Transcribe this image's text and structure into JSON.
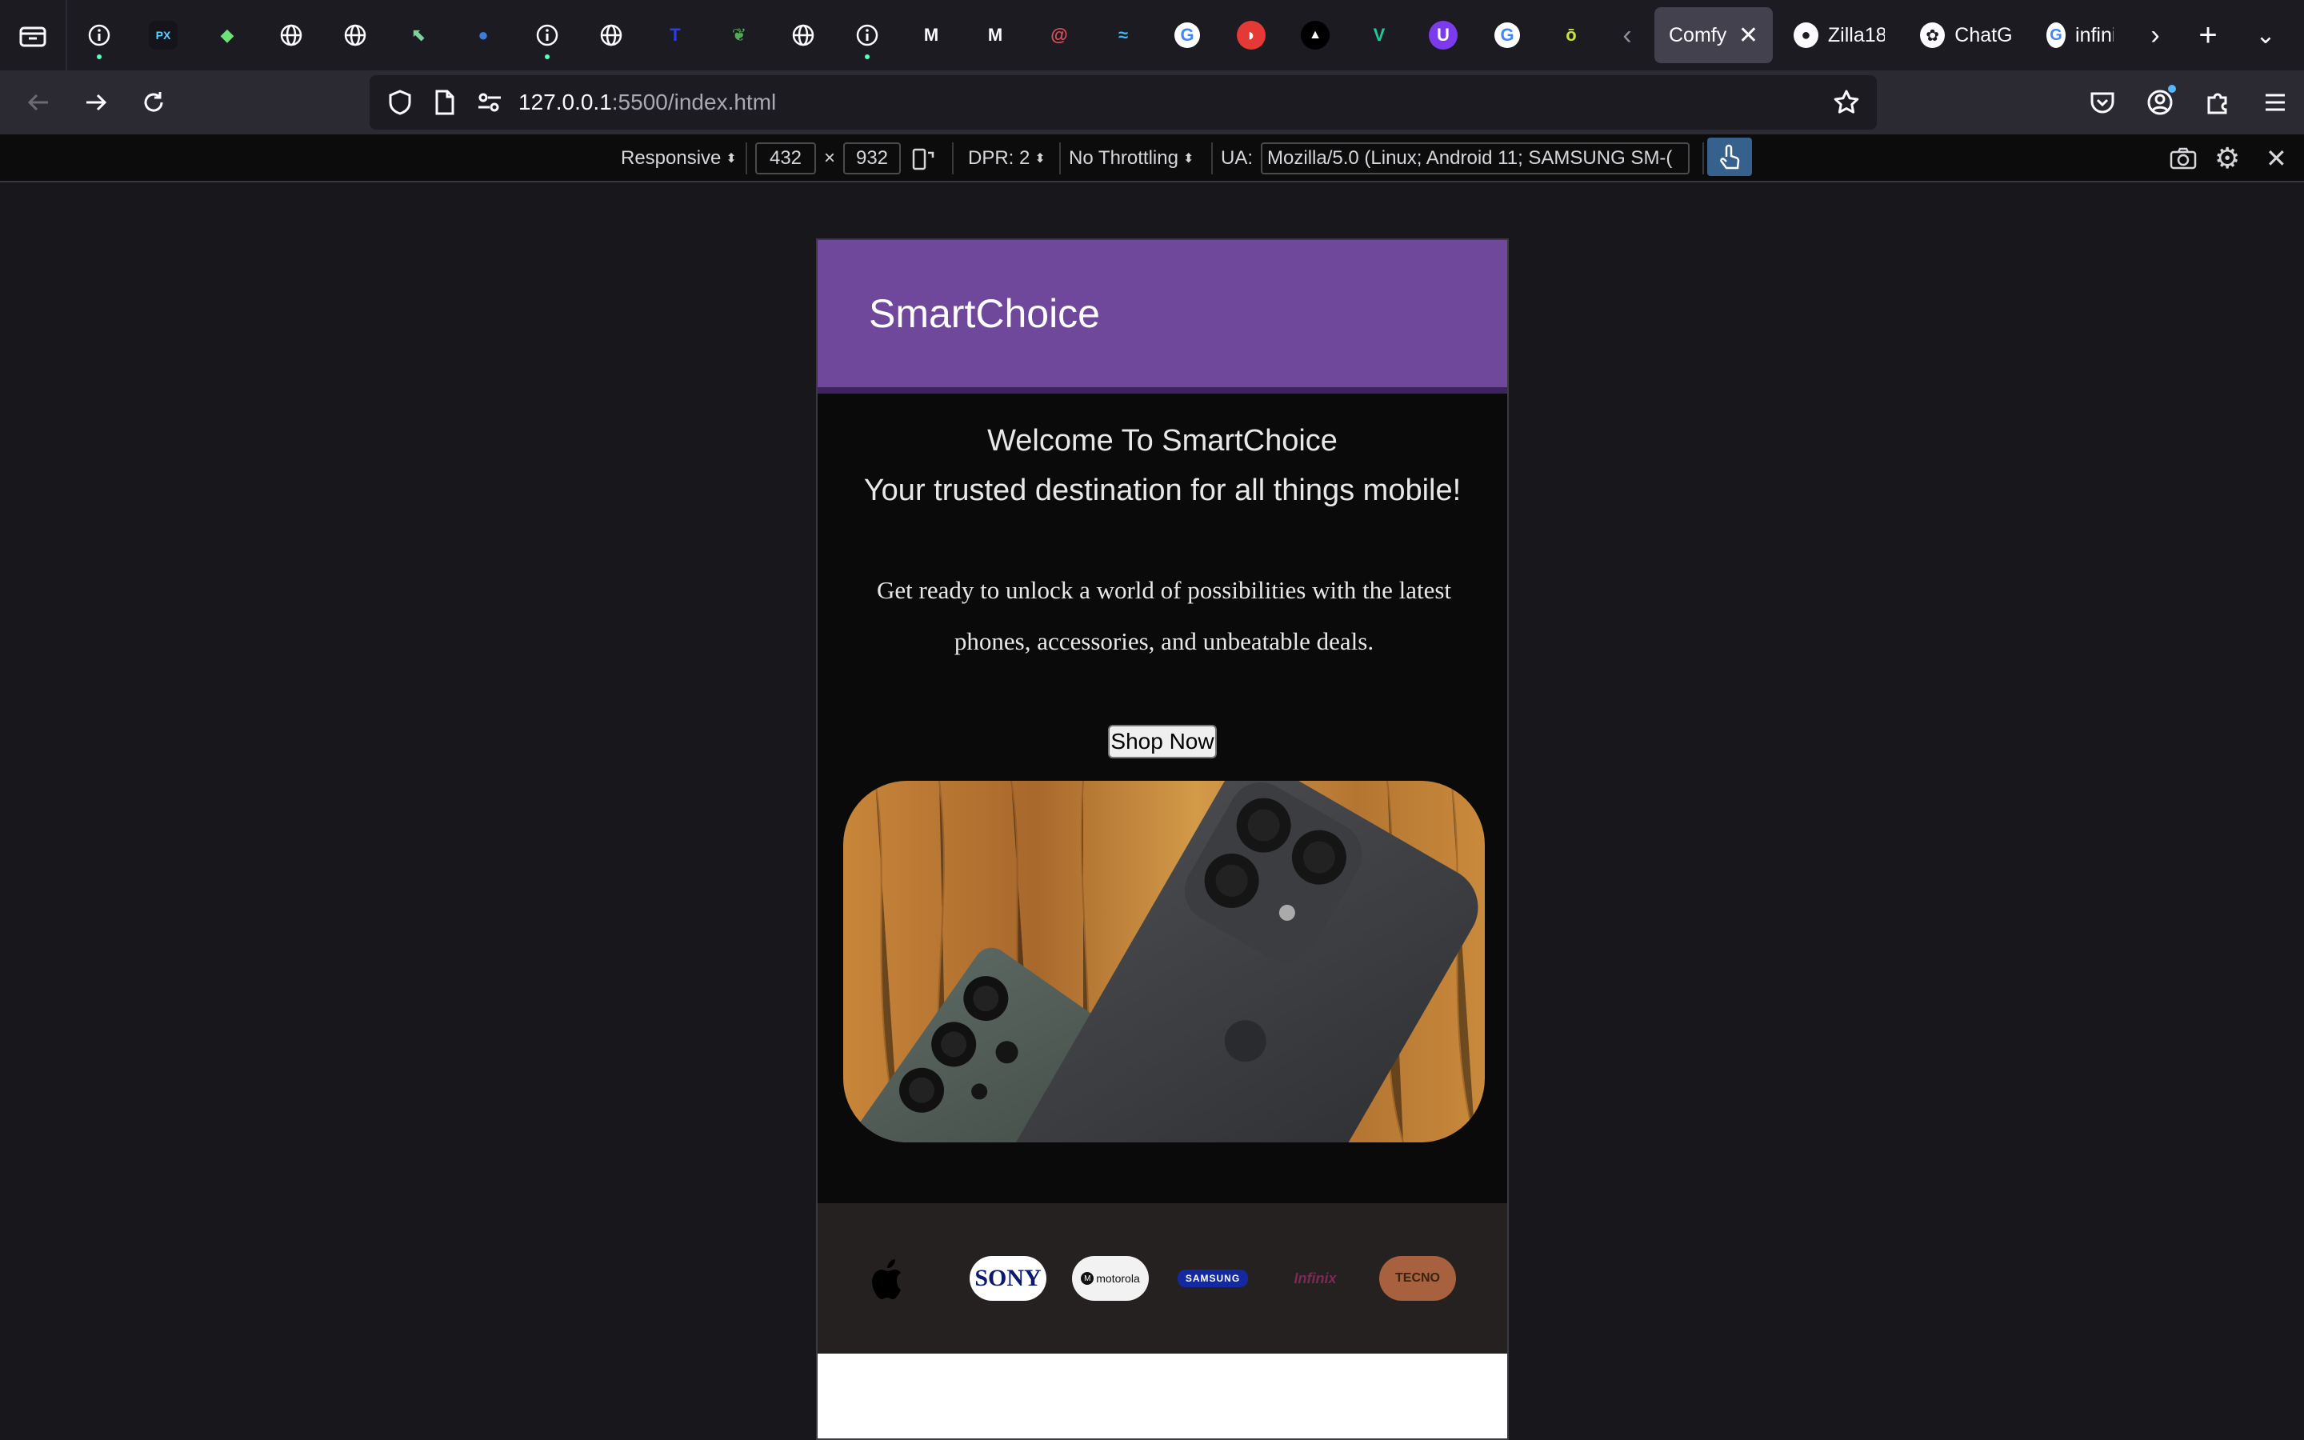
{
  "browser": {
    "pinned_tabs": [
      {
        "icon": "info-icon",
        "color": "#fbfbfe",
        "active_dot": true
      },
      {
        "icon": "pixel-app-icon",
        "color": "#5ad2ff",
        "active_dot": false
      },
      {
        "icon": "frog-icon",
        "color": "#6ee27a",
        "active_dot": false
      },
      {
        "icon": "globe-icon",
        "color": "#fbfbfe",
        "active_dot": false
      },
      {
        "icon": "globe-icon",
        "color": "#fbfbfe",
        "active_dot": false
      },
      {
        "icon": "cursor-app-icon",
        "color": "#7fd19b",
        "active_dot": false
      },
      {
        "icon": "blue-moon-icon",
        "color": "#3b7ddd",
        "active_dot": false
      },
      {
        "icon": "info-icon",
        "color": "#fbfbfe",
        "active_dot": true
      },
      {
        "icon": "globe-icon",
        "color": "#fbfbfe",
        "active_dot": false
      },
      {
        "icon": "t-letter-icon",
        "color": "#2a3cf0",
        "active_dot": false
      },
      {
        "icon": "leaf-icon",
        "color": "#4caf50",
        "active_dot": false
      },
      {
        "icon": "globe-icon",
        "color": "#fbfbfe",
        "active_dot": false
      },
      {
        "icon": "info-icon",
        "color": "#fbfbfe",
        "active_dot": true
      },
      {
        "icon": "m-letter-icon",
        "color": "#fbfbfe",
        "active_dot": false
      },
      {
        "icon": "m-letter-icon",
        "color": "#fbfbfe",
        "active_dot": false
      },
      {
        "icon": "debian-swirl-icon",
        "color": "#e0505a",
        "active_dot": false
      },
      {
        "icon": "tailwind-icon",
        "color": "#38bdf8",
        "active_dot": false
      },
      {
        "icon": "google-icon",
        "color": "#4285f4",
        "active_dot": false
      },
      {
        "icon": "red-shape-icon",
        "color": "#e53935",
        "active_dot": false
      },
      {
        "icon": "triangle-icon",
        "color": "#fbfbfe",
        "active_dot": false
      },
      {
        "icon": "v-letter-icon",
        "color": "#20c997",
        "active_dot": false
      },
      {
        "icon": "u-shield-icon",
        "color": "#7c3aed",
        "active_dot": false
      },
      {
        "icon": "google-icon",
        "color": "#4285f4",
        "active_dot": false
      },
      {
        "icon": "o-letter-icon",
        "color": "#c6e53a",
        "active_dot": false
      }
    ],
    "tabs": [
      {
        "label": "Comfy (",
        "selected": true,
        "favicon": "",
        "close": "✕"
      },
      {
        "label": "Zilla18",
        "selected": false,
        "favicon": "github-icon"
      },
      {
        "label": "ChatG",
        "selected": false,
        "favicon": "chatgpt-icon"
      },
      {
        "label": "infinix",
        "selected": false,
        "favicon": "google-icon"
      }
    ],
    "url": {
      "host": "127.0.0.1",
      "rest": ":5500/index.html"
    }
  },
  "rdm": {
    "device": "Responsive",
    "width": "432",
    "height": "932",
    "times": "×",
    "dpr": "DPR: 2",
    "throttling": "No Throttling",
    "ua_label": "UA:",
    "ua_value": "Mozilla/5.0 (Linux; Android 11; SAMSUNG SM-("
  },
  "site": {
    "brand": "SmartChoice",
    "welcome": "Welcome To SmartChoice",
    "tagline": "Your trusted destination for all things mobile!",
    "intro": "Get ready to unlock a world of possibilities with the latest phones, accessories, and unbeatable deals.",
    "cta": "Shop Now",
    "brands": [
      {
        "name": "iPhone",
        "text": "iPhone"
      },
      {
        "name": "Sony",
        "text": "SONY"
      },
      {
        "name": "Motorola",
        "text": "motorola"
      },
      {
        "name": "Samsung",
        "text": "SAMSUNG"
      },
      {
        "name": "Infinix",
        "text": "Infinix"
      },
      {
        "name": "Tecno",
        "text": "TECNO"
      }
    ]
  },
  "colors": {
    "header_purple": "#6f479b",
    "hero_bg": "#0a0a0a",
    "brands_bg": "#242120"
  }
}
